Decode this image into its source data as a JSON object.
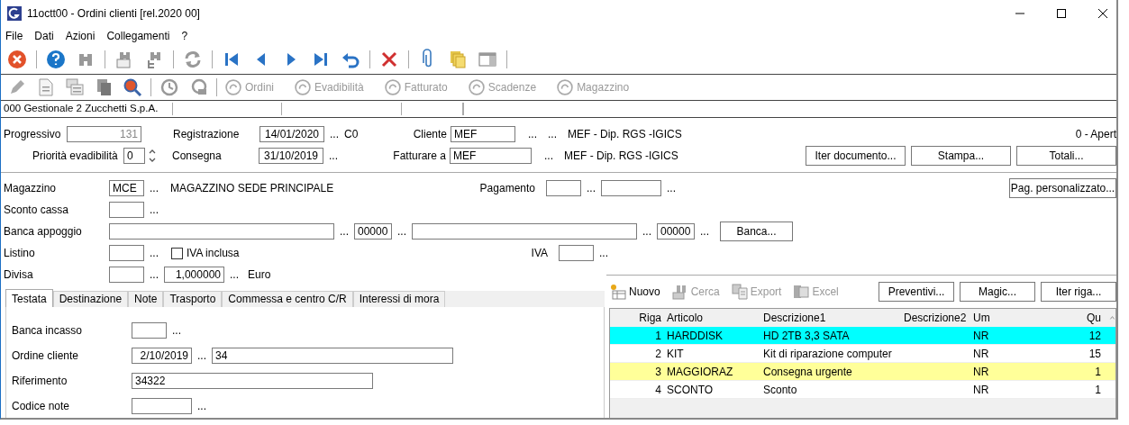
{
  "window": {
    "title": "11octt00 - Ordini clienti  [rel.2020 00]"
  },
  "menu": [
    "File",
    "Dati",
    "Azioni",
    "Collegamenti",
    "?"
  ],
  "toolbar2": [
    {
      "label": "Ordini",
      "disabled": true
    },
    {
      "label": "Evadibilità",
      "disabled": true
    },
    {
      "label": "Fatturato",
      "disabled": true
    },
    {
      "label": "Scadenze",
      "disabled": true
    },
    {
      "label": "Magazzino",
      "disabled": true
    }
  ],
  "status_bar": [
    "000 Gestionale 2 Zucchetti S.p.A."
  ],
  "header": {
    "progressivo": {
      "label": "Progressivo",
      "value": "131",
      "disabled": true
    },
    "priorita": {
      "label": "Priorità evadibilità",
      "value": "0"
    },
    "registrazione": {
      "label": "Registrazione",
      "value": "14/01/2020",
      "lookup": "...",
      "code": "C0"
    },
    "consegna": {
      "label": "Consegna",
      "value": "31/10/2019",
      "lookup": "..."
    },
    "cliente": {
      "label": "Cliente",
      "value": "MEF",
      "lookups": [
        "...",
        "..."
      ],
      "name": "MEF - Dip. RGS -IGICS"
    },
    "fatturare": {
      "label": "Fatturare a",
      "value": "MEF",
      "lookups": [
        "..."
      ],
      "name": "MEF - Dip. RGS -IGICS"
    },
    "stato": "0 - Apert",
    "buttons": [
      "Iter documento...",
      "Stampa...",
      "Totali..."
    ]
  },
  "main": {
    "magazzino": {
      "label": "Magazzino",
      "value": "MCE",
      "lookup": "...",
      "description": "MAGAZZINO SEDE PRINCIPALE"
    },
    "pagamento": {
      "label": "Pagamento",
      "lookups": [
        "...",
        "..."
      ]
    },
    "pag_button": "Pag. personalizzato...",
    "sconto_cassa": {
      "label": "Sconto cassa",
      "lookup": "..."
    },
    "banca_appoggio": {
      "label": "Banca appoggio",
      "lookups": [
        "...",
        "...",
        "...",
        "..."
      ],
      "abi": "00000",
      "cab": "00000",
      "button": "Banca..."
    },
    "listino": {
      "label": "Listino",
      "lookup": "...",
      "checkbox": {
        "label": "IVA inclusa",
        "checked": false
      }
    },
    "iva": {
      "label": "IVA",
      "lookup": "..."
    },
    "divisa": {
      "label": "Divisa",
      "lookups": [
        "...",
        "..."
      ],
      "cambio": "1,000000",
      "currency": "Euro"
    }
  },
  "tabs": [
    {
      "label": "Testata",
      "selected": true
    },
    {
      "label": "Destinazione",
      "selected": false
    },
    {
      "label": "Note",
      "selected": false
    },
    {
      "label": "Trasporto",
      "selected": false
    },
    {
      "label": "Commessa e centro C/R",
      "selected": false
    },
    {
      "label": "Interessi di mora",
      "selected": false
    }
  ],
  "testata": {
    "banca_incasso": {
      "label": "Banca incasso",
      "lookup": "..."
    },
    "ordine_cliente": {
      "label": "Ordine cliente",
      "date": "2/10/2019",
      "lookup": "...",
      "number": "34"
    },
    "riferimento": {
      "label": "Riferimento",
      "value": "34322"
    },
    "codice_note": {
      "label": "Codice note",
      "lookup": "..."
    }
  },
  "grid": {
    "toolbar": [
      {
        "label": "Nuovo",
        "disabled": false
      },
      {
        "label": "Cerca",
        "disabled": true
      },
      {
        "label": "Export",
        "disabled": true
      },
      {
        "label": "Excel",
        "disabled": true
      }
    ],
    "buttons": [
      "Preventivi...",
      "Magic...",
      "Iter riga..."
    ],
    "columns": [
      "Riga",
      "Articolo",
      "Descrizione1",
      "Descrizione2",
      "Um",
      "Qu"
    ],
    "rows": [
      {
        "cells": [
          "1",
          "HARDDISK",
          "HD 2TB 3,3 SATA",
          "",
          "NR",
          "12"
        ],
        "color": "#00ffff"
      },
      {
        "cells": [
          "2",
          "KIT",
          "Kit di riparazione computer",
          "",
          "NR",
          "15"
        ],
        "color": "#ffffff"
      },
      {
        "cells": [
          "3",
          "MAGGIORAZ",
          "Consegna urgente",
          "",
          "NR",
          "1"
        ],
        "color": "#ffff99"
      },
      {
        "cells": [
          "4",
          "SCONTO",
          "Sconto",
          "",
          "NR",
          "1"
        ],
        "color": "#ffffff"
      }
    ]
  }
}
